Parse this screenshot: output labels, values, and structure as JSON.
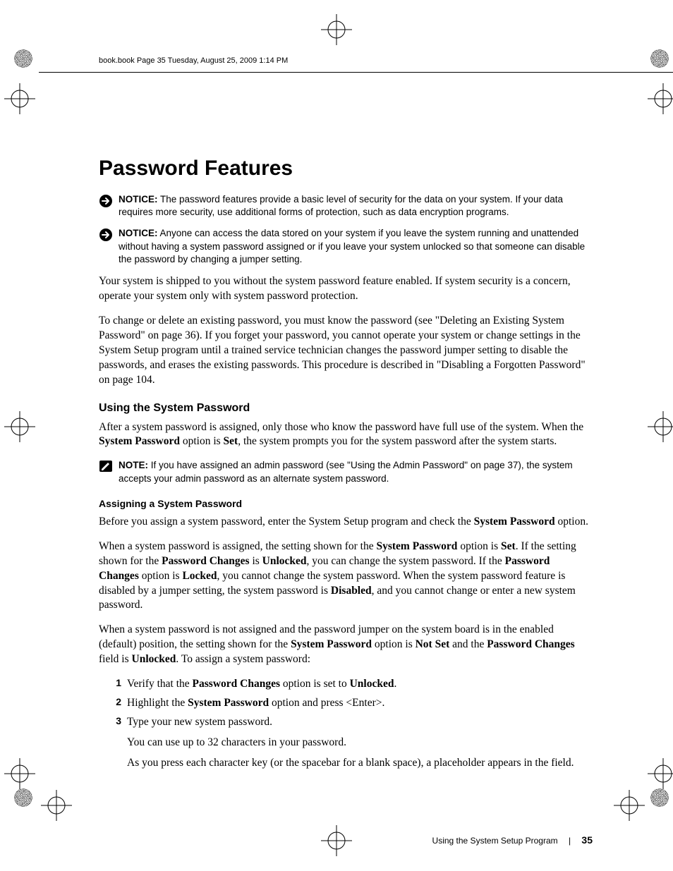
{
  "runningHeader": "book.book  Page 35  Tuesday, August 25, 2009  1:14 PM",
  "title": "Password Features",
  "notice1": {
    "label": "NOTICE:",
    "text": " The password features provide a basic level of security for the data on your system. If your data requires more security, use additional forms of protection, such as data encryption programs."
  },
  "notice2": {
    "label": "NOTICE:",
    "text": " Anyone can access the data stored on your system if you leave the system running and unattended without having a system password assigned or if you leave your system unlocked so that someone can disable the password by changing a jumper setting."
  },
  "para1": "Your system is shipped to you without the system password feature enabled. If system security is a concern, operate your system only with system password protection.",
  "para2": "To change or delete an existing password, you must know the password (see \"Deleting an Existing System Password\" on page 36). If you forget your password, you cannot operate your system or change settings in the System Setup program until a trained service technician changes the password jumper setting to disable the passwords, and erases the existing passwords. This procedure is described in \"Disabling a Forgotten Password\" on page 104.",
  "h2": "Using the System Password",
  "para3_a": "After a system password is assigned, only those who know the password have full use of the system. When the ",
  "para3_b": "System Password",
  "para3_c": " option is ",
  "para3_d": "Set",
  "para3_e": ", the system prompts you for the system password after the system starts.",
  "note1": {
    "label": "NOTE:",
    "text": " If you have assigned an admin password (see \"Using the Admin Password\" on page 37), the system accepts your admin password as an alternate system password."
  },
  "h3": "Assigning a System Password",
  "para4_a": "Before you assign a system password, enter the System Setup program and check the ",
  "para4_b": "System Password",
  "para4_c": " option.",
  "para5_a": "When a system password is assigned, the setting shown for the ",
  "para5_b": "System Password",
  "para5_c": " option is ",
  "para5_d": "Set",
  "para5_e": ". If the setting shown for the ",
  "para5_f": "Password Changes",
  "para5_g": " is ",
  "para5_h": "Unlocked",
  "para5_i": ", you can change the system password. If the ",
  "para5_j": "Password Changes",
  "para5_k": " option is ",
  "para5_l": "Locked",
  "para5_m": ", you cannot change the system password. When the system password feature is disabled by a jumper setting, the system password is ",
  "para5_n": "Disabled",
  "para5_o": ", and you cannot change or enter a new system password.",
  "para6_a": "When a system password is not assigned and the password jumper on the system board is in the enabled (default) position, the setting shown for the ",
  "para6_b": "System Password",
  "para6_c": " option is ",
  "para6_d": "Not Set",
  "para6_e": " and the ",
  "para6_f": "Password Changes",
  "para6_g": " field is ",
  "para6_h": "Unlocked",
  "para6_i": ". To assign a system password:",
  "steps": {
    "s1_a": "Verify that the ",
    "s1_b": "Password Changes",
    "s1_c": " option is set to ",
    "s1_d": "Unlocked",
    "s1_e": ".",
    "s2_a": "Highlight the ",
    "s2_b": "System Password",
    "s2_c": " option and press <Enter>.",
    "s3_a": "Type your new system password.",
    "s3_b": "You can use up to 32 characters in your password.",
    "s3_c": "As you press each character key (or the spacebar for a blank space), a placeholder appears in the field."
  },
  "footer": {
    "section": "Using the System Setup Program",
    "page": "35"
  }
}
